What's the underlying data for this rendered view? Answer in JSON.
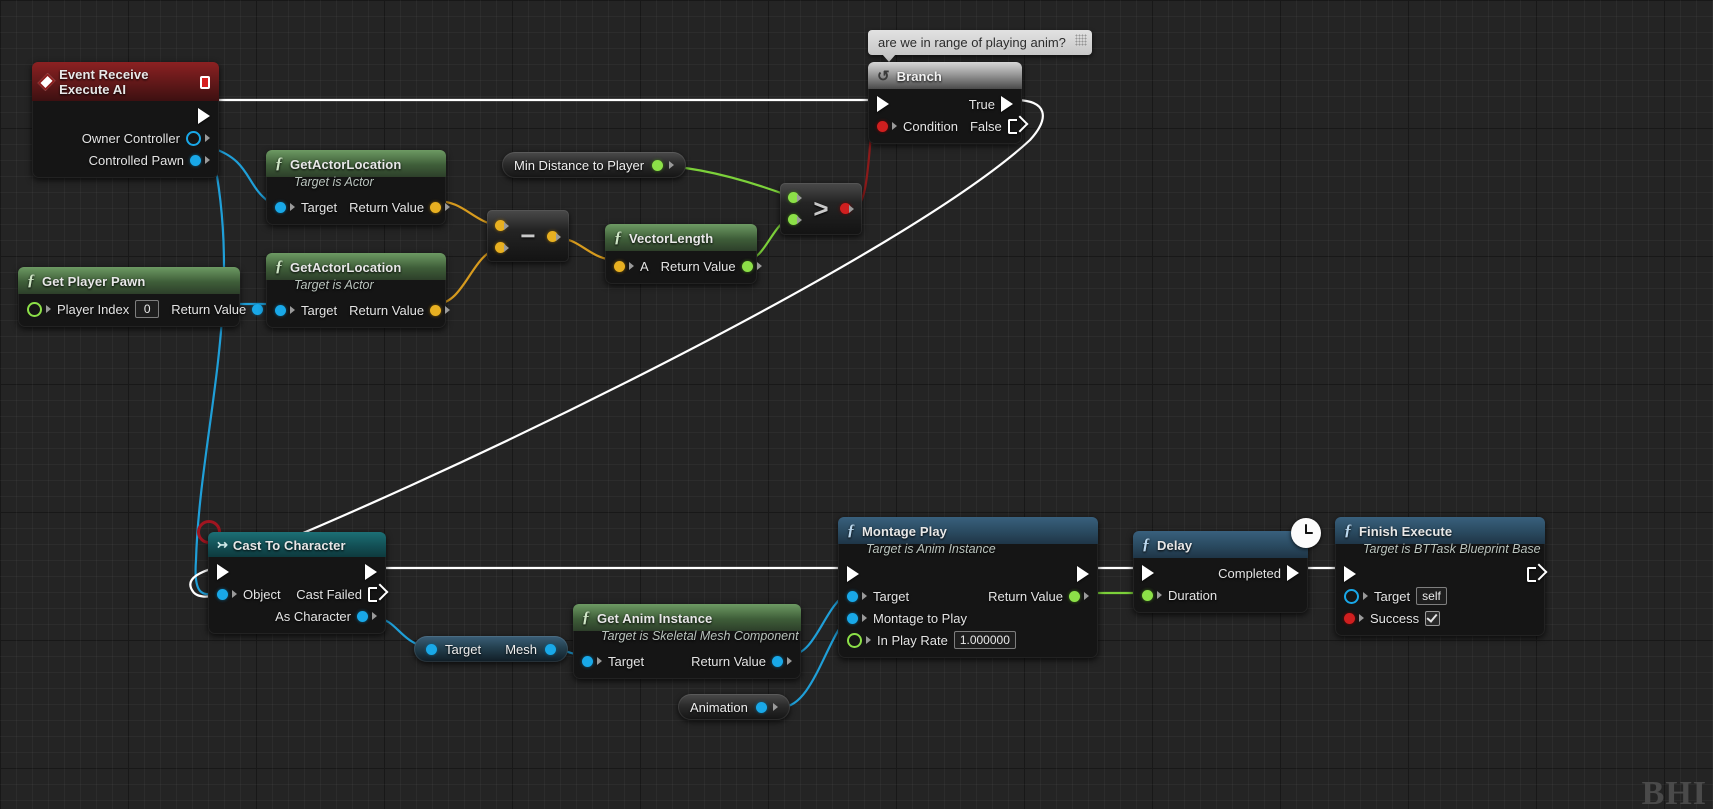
{
  "graph": {
    "comment": {
      "text": "are we in range of playing anim?"
    },
    "watermark": "BHI"
  },
  "nodes": {
    "event_receive_execute_ai": {
      "title": "Event Receive Execute AI",
      "icon": "event-diamond-icon",
      "badge": "stop-square-icon",
      "pins": [
        {
          "label": "Owner Controller",
          "type": "object-ring"
        },
        {
          "label": "Controlled Pawn",
          "type": "object"
        }
      ]
    },
    "get_player_pawn": {
      "title": "Get Player Pawn",
      "icon": "function-f-icon",
      "input_label": "Player Index",
      "input_value": "0",
      "output_label": "Return Value"
    },
    "get_actor_location_1": {
      "title": "GetActorLocation",
      "subtitle": "Target is Actor",
      "icon": "function-f-icon",
      "input_label": "Target",
      "output_label": "Return Value"
    },
    "get_actor_location_2": {
      "title": "GetActorLocation",
      "subtitle": "Target is Actor",
      "icon": "function-f-icon",
      "input_label": "Target",
      "output_label": "Return Value"
    },
    "subtract": {
      "glyph": "−",
      "name": "subtract-node"
    },
    "vector_length": {
      "title": "VectorLength",
      "icon": "function-f-icon",
      "input_label": "A",
      "output_label": "Return Value"
    },
    "min_distance_to_player": {
      "label": "Min Distance to Player"
    },
    "greater_than": {
      "glyph": ">",
      "name": "greater-than-node"
    },
    "branch": {
      "title": "Branch",
      "icon": "loop-icon",
      "condition_label": "Condition",
      "true_label": "True",
      "false_label": "False"
    },
    "cast_to_character": {
      "title": "Cast To Character",
      "icon": "cast-arrow-icon",
      "object_label": "Object",
      "cast_failed_label": "Cast Failed",
      "as_character_label": "As Character"
    },
    "mesh_getter": {
      "input_label": "Target",
      "output_label": "Mesh"
    },
    "get_anim_instance": {
      "title": "Get Anim Instance",
      "subtitle": "Target is Skeletal Mesh Component",
      "icon": "function-f-icon",
      "input_label": "Target",
      "output_label": "Return Value"
    },
    "animation_var": {
      "label": "Animation"
    },
    "montage_play": {
      "title": "Montage Play",
      "subtitle": "Target is Anim Instance",
      "icon": "function-f-icon",
      "target_label": "Target",
      "montage_label": "Montage to Play",
      "play_rate_label": "In Play Rate",
      "play_rate_value": "1.000000",
      "return_label": "Return Value"
    },
    "delay": {
      "title": "Delay",
      "icon": "function-f-icon",
      "badge": "clock-icon",
      "duration_label": "Duration",
      "completed_label": "Completed"
    },
    "finish_execute": {
      "title": "Finish Execute",
      "subtitle": "Target is BTTask Blueprint Base",
      "icon": "function-f-icon",
      "target_label": "Target",
      "target_value": "self",
      "success_label": "Success"
    }
  },
  "colors": {
    "exec_wire": "#ffffff",
    "object_wire": "#1f9fd8",
    "vector_wire": "#d79b1e",
    "float_wire": "#7cd13a",
    "bool_wire": "#8c1a1a"
  }
}
